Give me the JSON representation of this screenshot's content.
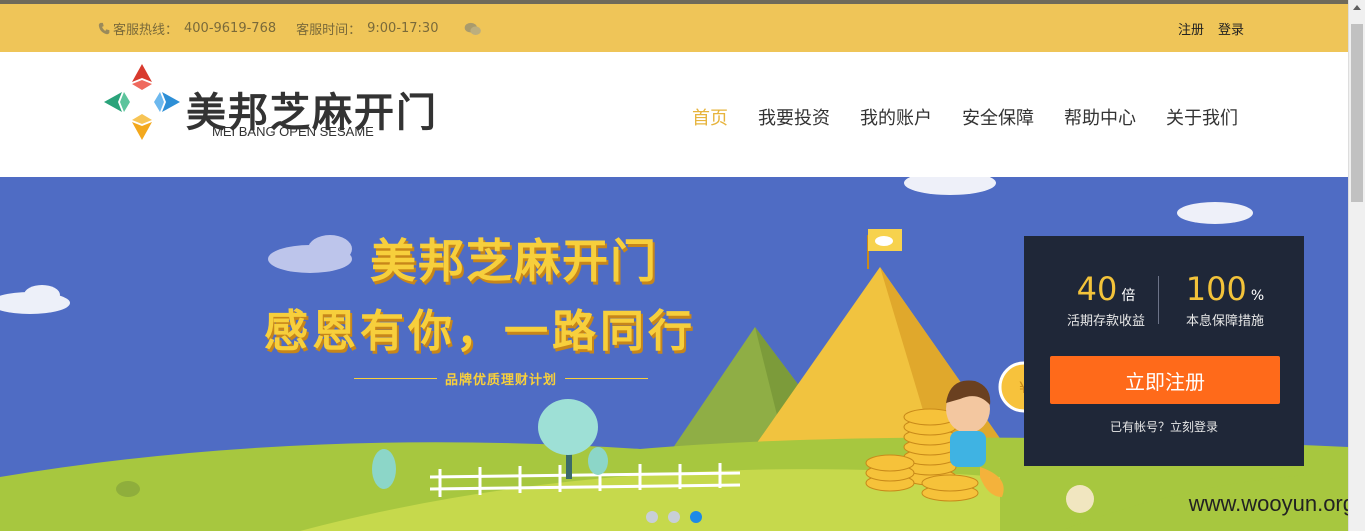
{
  "topbar": {
    "hotline_label": "客服热线：",
    "hotline_number": "400-9619-768",
    "hours_label": "客服时间：",
    "hours_value": "9:00-17:30",
    "register": "注册",
    "login": "登录"
  },
  "logo": {
    "name": "美邦芝麻开门",
    "english": "MEI BANG OPEN SESAME"
  },
  "nav": {
    "items": [
      "首页",
      "我要投资",
      "我的账户",
      "安全保障",
      "帮助中心",
      "关于我们"
    ],
    "active_index": 0
  },
  "banner": {
    "headline": "美邦芝麻开门",
    "slogan": "感恩有你，一路同行",
    "subtitle": "品牌优质理财计划"
  },
  "panel": {
    "stat1_value": "40",
    "stat1_unit": "倍",
    "stat1_label": "活期存款收益",
    "stat2_value": "100",
    "stat2_unit": "%",
    "stat2_label": "本息保障措施",
    "register_button": "立即注册",
    "login_link": "已有帐号？立刻登录"
  },
  "carousel": {
    "slide_count": 3,
    "active_slide": 3
  },
  "watermark": "www.wooyun.org",
  "colors": {
    "topbar": "#efc558",
    "nav_active": "#e7b43d",
    "banner_bg": "#4f6cc4",
    "panel_bg": "#1f2738",
    "cta": "#ff6a1a",
    "dot_active": "#1d8ae8"
  }
}
